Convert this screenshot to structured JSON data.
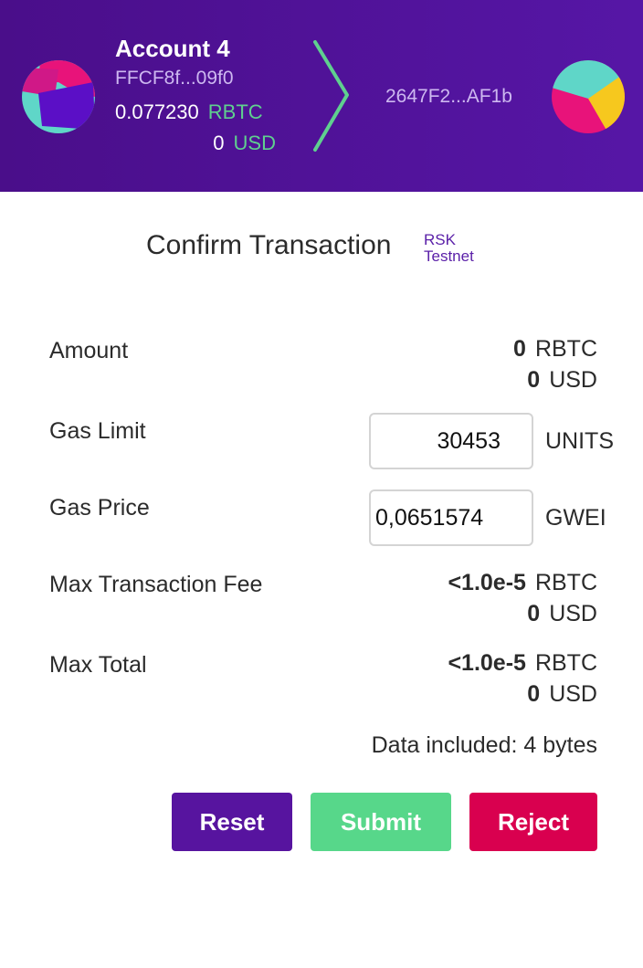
{
  "header": {
    "from": {
      "account_name": "Account 4",
      "address": "FFCF8f...09f0",
      "balance_rbtc": "0.077230",
      "rbtc_unit": "RBTC",
      "balance_usd": "0",
      "usd_unit": "USD"
    },
    "to": {
      "address": "2647F2...AF1b"
    },
    "arrow_icon": "chevron-right-icon"
  },
  "confirm": {
    "title": "Confirm Transaction",
    "network_line1": "RSK",
    "network_line2": "Testnet"
  },
  "fields": {
    "amount": {
      "label": "Amount",
      "rbtc": "0",
      "rbtc_unit": "RBTC",
      "usd": "0",
      "usd_unit": "USD"
    },
    "gas_limit": {
      "label": "Gas Limit",
      "value": "30453",
      "unit": "UNITS"
    },
    "gas_price": {
      "label": "Gas Price",
      "value": "0,0651574",
      "unit": "GWEI"
    },
    "max_fee": {
      "label": "Max Transaction Fee",
      "rbtc": "<1.0e-5",
      "rbtc_unit": "RBTC",
      "usd": "0",
      "usd_unit": "USD"
    },
    "max_total": {
      "label": "Max Total",
      "rbtc": "<1.0e-5",
      "rbtc_unit": "RBTC",
      "usd": "0",
      "usd_unit": "USD"
    },
    "data_included": "Data included: 4 bytes"
  },
  "buttons": {
    "reset": "Reset",
    "submit": "Submit",
    "reject": "Reject"
  },
  "colors": {
    "header_bg": "#5616a6",
    "accent_green": "#5fd08f",
    "reset_bg": "#57149f",
    "submit_bg": "#57d78a",
    "reject_bg": "#d9004f"
  }
}
